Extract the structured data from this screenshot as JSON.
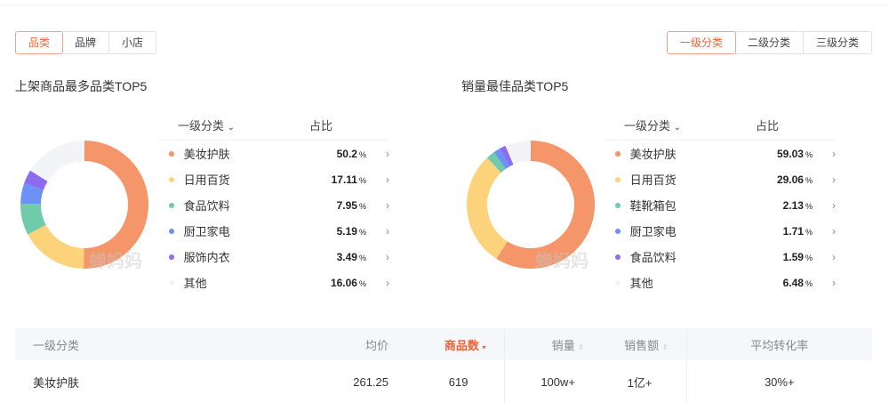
{
  "tabs_left": [
    "品类",
    "品牌",
    "小店"
  ],
  "tabs_right": [
    "一级分类",
    "二级分类",
    "三级分类"
  ],
  "watermark": "蝉妈妈",
  "panels": [
    {
      "title": "上架商品最多品类TOP5",
      "col1": "一级分类",
      "col2": "占比",
      "items": [
        {
          "name": "美妆护肤",
          "value": 50.2,
          "label": "50.2",
          "color": "#f4956a"
        },
        {
          "name": "日用百货",
          "value": 17.11,
          "label": "17.11",
          "color": "#fcd27a"
        },
        {
          "name": "食品饮料",
          "value": 7.95,
          "label": "7.95",
          "color": "#6fcbaa"
        },
        {
          "name": "厨卫家电",
          "value": 5.19,
          "label": "5.19",
          "color": "#6b93f5"
        },
        {
          "name": "服饰内衣",
          "value": 3.49,
          "label": "3.49",
          "color": "#8e6bf0"
        },
        {
          "name": "其他",
          "value": 16.06,
          "label": "16.06",
          "color": "#f2f4f7"
        }
      ]
    },
    {
      "title": "销量最佳品类TOP5",
      "col1": "一级分类",
      "col2": "占比",
      "items": [
        {
          "name": "美妆护肤",
          "value": 59.03,
          "label": "59.03",
          "color": "#f4956a"
        },
        {
          "name": "日用百货",
          "value": 29.06,
          "label": "29.06",
          "color": "#fcd27a"
        },
        {
          "name": "鞋靴箱包",
          "value": 2.13,
          "label": "2.13",
          "color": "#6fcbaa"
        },
        {
          "name": "厨卫家电",
          "value": 1.71,
          "label": "1.71",
          "color": "#6b93f5"
        },
        {
          "name": "食品饮料",
          "value": 1.59,
          "label": "1.59",
          "color": "#8e6bf0"
        },
        {
          "name": "其他",
          "value": 6.48,
          "label": "6.48",
          "color": "#f2f4f7"
        }
      ]
    }
  ],
  "percent": "%",
  "table": {
    "headers": [
      "一级分类",
      "均价",
      "商品数",
      "销量",
      "销售额",
      "平均转化率"
    ],
    "rows": [
      [
        "美妆护肤",
        "261.25",
        "619",
        "100w+",
        "1亿+",
        "30%+"
      ]
    ]
  }
}
